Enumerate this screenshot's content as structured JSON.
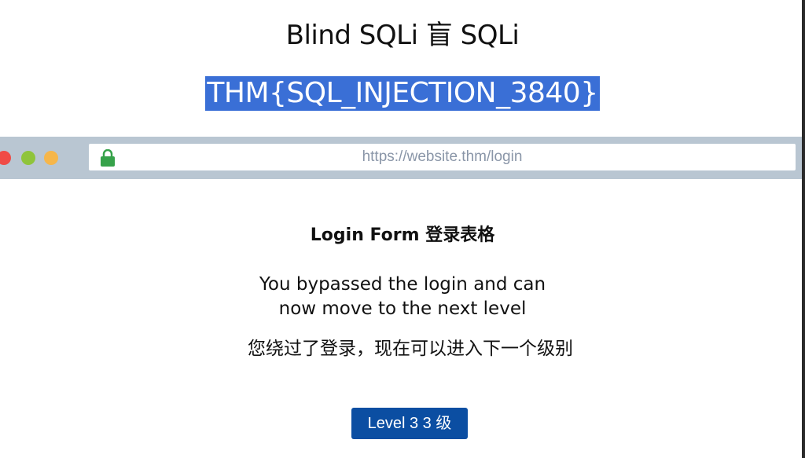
{
  "header": {
    "title": "Blind SQLi  盲 SQLi",
    "flag": "THM{SQL_INJECTION_3840}"
  },
  "browser": {
    "url": "https://website.thm/login",
    "icons": {
      "lock": "lock-icon",
      "close": "close-dot",
      "minimize": "minimize-dot",
      "maximize": "maximize-dot"
    },
    "colors": {
      "bar": "#b9c6d2",
      "lock": "#36a24a"
    }
  },
  "form": {
    "heading": "Login Form  登录表格",
    "message_en": "You bypassed the login and can now move to the next level",
    "message_zh": "您绕过了登录，现在可以进入下一个级别",
    "level_button_label": "Level 3  3 级"
  },
  "colors": {
    "flag_highlight": "#3a6fd6",
    "button": "#0b4ea2"
  }
}
